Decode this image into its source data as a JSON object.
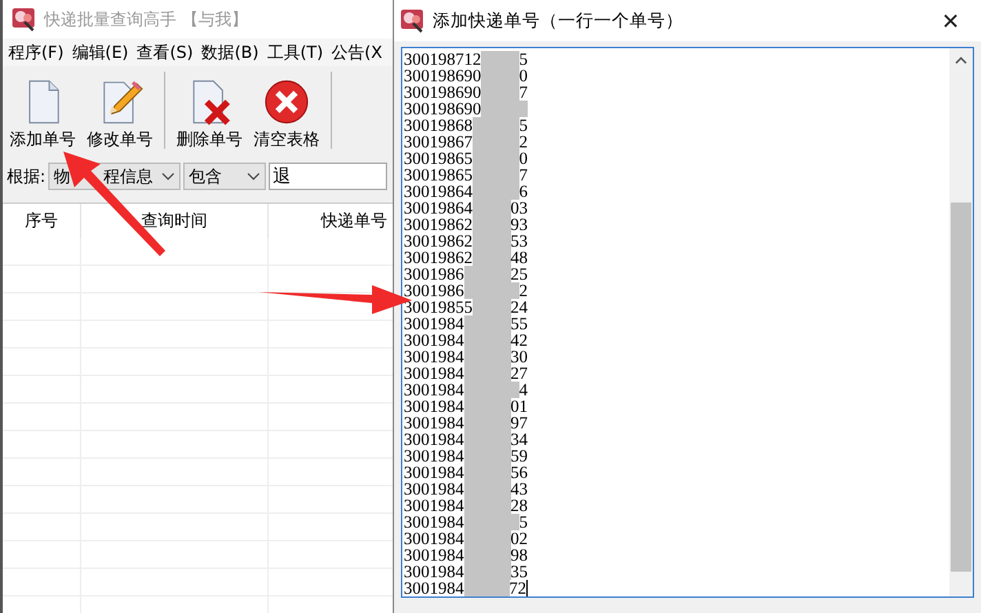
{
  "main_window": {
    "title": "快递批量查询高手 【与我】",
    "active": false,
    "menu": [
      "程序(F)",
      "编辑(E)",
      "查看(S)",
      "数据(B)",
      "工具(T)",
      "公告(X"
    ],
    "toolbar": [
      {
        "label": "添加单号",
        "kind": "add"
      },
      {
        "label": "修改单号",
        "kind": "edit"
      },
      {
        "label": "删除单号",
        "kind": "delete"
      },
      {
        "label": "清空表格",
        "kind": "clear"
      }
    ],
    "filter": {
      "label": "根据:",
      "field": [
        "物",
        "程信息"
      ],
      "match": "包含",
      "value": "退"
    },
    "table": {
      "columns": [
        "序号",
        "查询时间",
        "快递单号"
      ]
    }
  },
  "dialog": {
    "title": "添加快递单号（一行一个单号）",
    "close": "✕",
    "lines": [
      {
        "prefix": "300198712",
        "suffix": "5"
      },
      {
        "prefix": "300198690",
        "suffix": "0"
      },
      {
        "prefix": "300198690",
        "suffix": "7"
      },
      {
        "prefix": "300198690"
      },
      {
        "prefix": "30019868",
        "suffix": "5"
      },
      {
        "prefix": "30019867",
        "suffix": "2"
      },
      {
        "prefix": "30019865",
        "suffix": "0"
      },
      {
        "prefix": "30019865",
        "suffix": "7"
      },
      {
        "prefix": "30019864",
        "suffix": "6"
      },
      {
        "prefix": "30019864",
        "suffix": "03"
      },
      {
        "prefix": "30019862",
        "suffix": "93"
      },
      {
        "prefix": "30019862",
        "suffix": "53"
      },
      {
        "prefix": "30019862",
        "suffix": "48"
      },
      {
        "prefix": "3001986",
        "suffix": "25"
      },
      {
        "prefix": "3001986",
        "suffix": "2"
      },
      {
        "prefix": "30019855",
        "suffix": "24"
      },
      {
        "prefix": "3001984",
        "suffix": "55"
      },
      {
        "prefix": "3001984",
        "suffix": "42"
      },
      {
        "prefix": "3001984",
        "suffix": "30"
      },
      {
        "prefix": "3001984",
        "suffix": "27"
      },
      {
        "prefix": "3001984",
        "suffix": "4"
      },
      {
        "prefix": "3001984",
        "suffix": "01"
      },
      {
        "prefix": "3001984",
        "suffix": "97"
      },
      {
        "prefix": "3001984",
        "suffix": "34"
      },
      {
        "prefix": "3001984",
        "suffix": "59"
      },
      {
        "prefix": "3001984",
        "suffix": "56"
      },
      {
        "prefix": "3001984",
        "suffix": "43"
      },
      {
        "prefix": "3001984",
        "suffix": "28"
      },
      {
        "prefix": "3001984",
        "suffix": "5"
      },
      {
        "prefix": "3001984",
        "suffix": "02"
      },
      {
        "prefix": "3001984",
        "suffix": "98"
      },
      {
        "prefix": "3001984",
        "suffix": "35"
      },
      {
        "prefix": "3001984",
        "suffix": "72"
      }
    ]
  }
}
